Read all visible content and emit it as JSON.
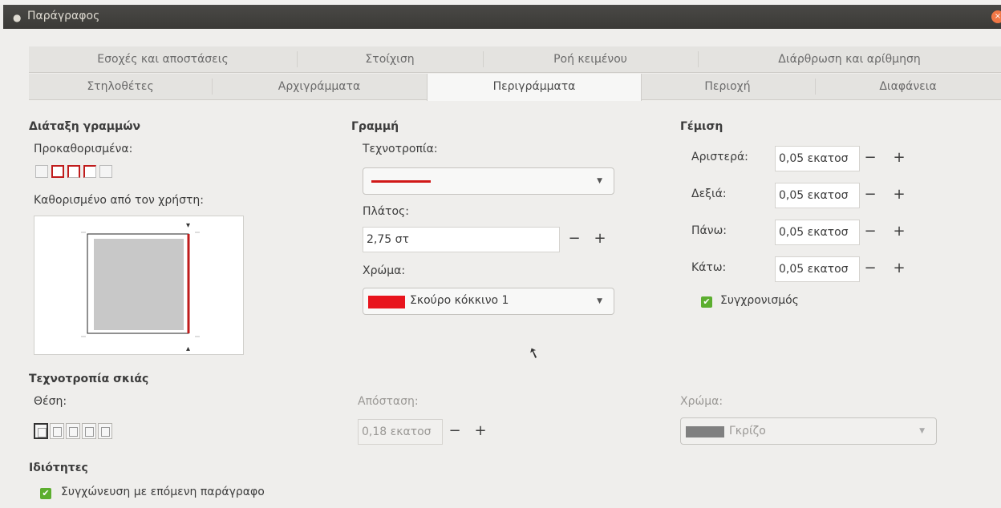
{
  "window": {
    "title": "Παράγραφος"
  },
  "tabs": {
    "row1": [
      "Εσοχές και αποστάσεις",
      "Στοίχιση",
      "Ροή κειμένου",
      "Διάρθρωση και αρίθμηση"
    ],
    "row2": [
      "Στηλοθέτες",
      "Αρχιγράμματα",
      "Περιγράμματα",
      "Περιοχή",
      "Διαφάνεια"
    ],
    "active": "Περιγράμματα"
  },
  "line_arrangement": {
    "heading": "Διάταξη γραμμών",
    "presets_label": "Προκαθορισμένα:",
    "user_defined_label": "Καθορισμένο από τον χρήστη:"
  },
  "line": {
    "heading": "Γραμμή",
    "style_label": "Τεχνοτροπία:",
    "style_color": "#d01818",
    "width_label": "Πλάτος:",
    "width_value": "2,75 στ",
    "color_label": "Χρώμα:",
    "color_value": "Σκούρο κόκκινο 1",
    "color_swatch": "#e8141c"
  },
  "padding": {
    "heading": "Γέμιση",
    "left_label": "Αριστερά:",
    "left_value": "0,05 εκατοσ",
    "right_label": "Δεξιά:",
    "right_value": "0,05 εκατοσ",
    "top_label": "Πάνω:",
    "top_value": "0,05 εκατοσ",
    "bottom_label": "Κάτω:",
    "bottom_value": "0,05 εκατοσ",
    "sync_label": "Συγχρονισμός",
    "sync_checked": true
  },
  "shadow": {
    "heading": "Τεχνοτροπία σκιάς",
    "position_label": "Θέση:",
    "distance_label": "Απόσταση:",
    "distance_value": "0,18 εκατοσ",
    "color_label": "Χρώμα:",
    "color_value": "Γκρίζο",
    "color_swatch": "#808080"
  },
  "properties": {
    "heading": "Ιδιότητες",
    "merge_label": "Συγχώνευση με επόμενη παράγραφο",
    "merge_checked": true
  },
  "symbols": {
    "minus": "−",
    "plus": "+",
    "dropdown": "▼",
    "check": "✔",
    "close": "×",
    "cursor": "➚"
  }
}
